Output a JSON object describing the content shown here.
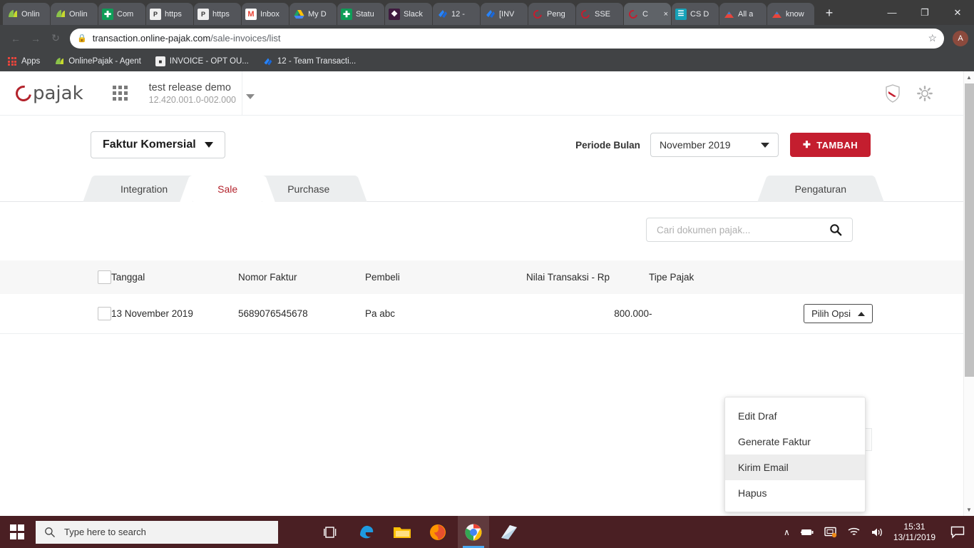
{
  "browser": {
    "tabs": [
      {
        "label": "Onlin",
        "favicon": "onlinepajak-leaf",
        "color": "#8bc34a",
        "active": false
      },
      {
        "label": "Onlin",
        "favicon": "onlinepajak-leaf",
        "color": "#8bc34a",
        "active": false
      },
      {
        "label": "Com",
        "favicon": "sheets-icon",
        "color": "#0f9d58",
        "active": false
      },
      {
        "label": "https",
        "favicon": "document-icon",
        "color": "#ffffff",
        "active": false
      },
      {
        "label": "https",
        "favicon": "document-icon",
        "color": "#ffffff",
        "active": false
      },
      {
        "label": "Inbox",
        "favicon": "gmail-icon",
        "color": "#ffffff",
        "active": false
      },
      {
        "label": "My D",
        "favicon": "google-drive-icon",
        "color": "#ffffff",
        "active": false
      },
      {
        "label": "Statu",
        "favicon": "sheets-icon",
        "color": "#0f9d58",
        "active": false
      },
      {
        "label": "Slack",
        "favicon": "slack-icon",
        "color": "#3f1a3f",
        "active": false
      },
      {
        "label": "12 - ",
        "favicon": "jira-icon",
        "color": "#2684ff",
        "active": false
      },
      {
        "label": "[INV",
        "favicon": "jira-icon",
        "color": "#2684ff",
        "active": false
      },
      {
        "label": "Peng",
        "favicon": "pajak-ring-icon",
        "color": "#c41e2f",
        "active": false
      },
      {
        "label": "SSE",
        "favicon": "pajak-ring-icon",
        "color": "#c41e2f",
        "active": false
      },
      {
        "label": "C",
        "favicon": "pajak-ring-icon",
        "color": "#c41e2f",
        "active": true
      },
      {
        "label": "CS D",
        "favicon": "book-icon",
        "color": "#17a2b8",
        "active": false
      },
      {
        "label": "All a",
        "favicon": "drive-tri-icon",
        "color": "#e8453c",
        "active": false
      },
      {
        "label": "know",
        "favicon": "drive-tri-icon",
        "color": "#e8453c",
        "active": false
      }
    ],
    "new_tab_label": "+",
    "close_tab_label": "×",
    "window_controls": {
      "minimize": "—",
      "maximize": "❐",
      "close": "✕"
    },
    "nav": {
      "back": "←",
      "forward": "→",
      "reload": "↻"
    },
    "url_secure": "transaction.online-pajak.com",
    "url_path": "/sale-invoices/list",
    "lock_icon": "lock-icon",
    "star_icon": "☆",
    "profile_initial": "A",
    "bookmarks": [
      {
        "label": "Apps",
        "icon": "apps-grid-icon",
        "color": "#e8453c"
      },
      {
        "label": "OnlinePajak - Agent",
        "icon": "onlinepajak-leaf-icon",
        "color": "#8bc34a"
      },
      {
        "label": "INVOICE - OPT OU...",
        "icon": "document-icon",
        "color": "#ffffff"
      },
      {
        "label": "12 - Team Transacti...",
        "icon": "jira-icon",
        "color": "#2684ff"
      }
    ]
  },
  "app": {
    "logo_text": "pajak",
    "org_name": "test release demo",
    "org_npwp": "12.420.001.0-002.000",
    "grid_icon": "apps-grid-icon",
    "shield_icon": "shield-icon",
    "gear_icon": "gear-icon",
    "doc_type_button": "Faktur Komersial",
    "periode_label": "Periode Bulan",
    "periode_value": "November  2019",
    "add_button": "TAMBAH",
    "add_icon": "plus-icon",
    "tabs": [
      {
        "label": "Integration",
        "active": false
      },
      {
        "label": "Sale",
        "active": true
      },
      {
        "label": "Purchase",
        "active": false
      }
    ],
    "settings_tab": "Pengaturan",
    "search_placeholder": "Cari dokumen pajak...",
    "search_value": "",
    "search_icon": "search-icon",
    "accent_color": "#c41e2f",
    "table": {
      "columns": [
        "Tanggal",
        "Nomor Faktur",
        "Pembeli",
        "Nilai Transaksi - Rp",
        "Tipe Pajak"
      ],
      "rows": [
        {
          "tanggal": "13 November 2019",
          "nomor_faktur": "5689076545678",
          "pembeli": "Pa abc",
          "nilai": "800.000",
          "tipe_pajak": "-",
          "action_label": "Pilih Opsi",
          "selected": false
        }
      ]
    },
    "options_menu": {
      "items": [
        {
          "label": "Edit Draf",
          "highlighted": false
        },
        {
          "label": "Generate Faktur",
          "highlighted": false
        },
        {
          "label": "Kirim Email",
          "highlighted": true
        },
        {
          "label": "Hapus",
          "highlighted": false
        }
      ]
    }
  },
  "taskbar": {
    "start_icon": "windows-logo-icon",
    "search_placeholder": "Type here to search",
    "search_icon": "search-icon",
    "items": [
      {
        "name": "task-view-icon"
      },
      {
        "name": "edge-icon"
      },
      {
        "name": "file-explorer-icon"
      },
      {
        "name": "firefox-icon"
      },
      {
        "name": "chrome-icon"
      },
      {
        "name": "mail-icon"
      }
    ],
    "tray": {
      "chevron": "∧",
      "battery_icon": "battery-icon",
      "display_icon": "display-icon",
      "wifi_icon": "wifi-icon",
      "volume_icon": "volume-icon",
      "time": "15:31",
      "date": "13/11/2019",
      "notification_icon": "notification-icon"
    }
  }
}
